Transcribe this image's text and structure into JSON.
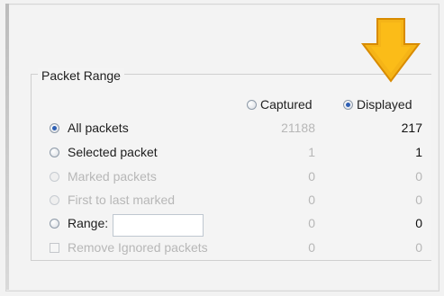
{
  "packet_range": {
    "title": "Packet Range",
    "columns": {
      "captured": "Captured",
      "displayed": "Displayed"
    },
    "header_selection": "Displayed",
    "rows": [
      {
        "label": "All packets",
        "selected": true,
        "enabled": true,
        "captured": "21188",
        "displayed": "217"
      },
      {
        "label": "Selected packet",
        "selected": false,
        "enabled": true,
        "captured": "1",
        "displayed": "1"
      },
      {
        "label": "Marked packets",
        "selected": false,
        "enabled": false,
        "captured": "0",
        "displayed": "0"
      },
      {
        "label": "First to last marked",
        "selected": false,
        "enabled": false,
        "captured": "0",
        "displayed": "0"
      },
      {
        "label": "Range:",
        "selected": false,
        "enabled": true,
        "captured": "0",
        "displayed": "0",
        "input_value": ""
      },
      {
        "label": "Remove Ignored packets",
        "type": "checkbox",
        "checked": false,
        "enabled": false,
        "captured": "0",
        "displayed": "0"
      }
    ]
  },
  "colors": {
    "arrow_fill": "#f5b417",
    "arrow_stroke": "#d88b00",
    "radio_selected": "#2d5fb4"
  },
  "icons": {
    "arrow": "down-arrow-icon",
    "radio": "radio-button-icon",
    "checkbox": "checkbox-icon"
  }
}
